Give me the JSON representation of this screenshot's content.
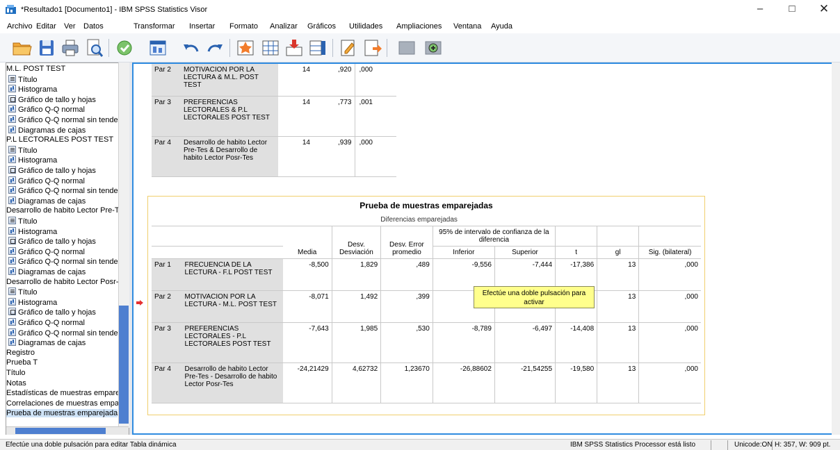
{
  "window": {
    "title": "*Resultado1 [Documento1] - IBM SPSS Statistics Visor",
    "minimize_glyph": "–",
    "maximize_glyph": "□",
    "close_glyph": "✕"
  },
  "menu": [
    "Archivo",
    "Editar",
    "Ver",
    "Datos",
    "Transformar",
    "Insertar",
    "Formato",
    "Analizar",
    "Gráficos",
    "Utilidades",
    "Ampliaciones",
    "Ventana",
    "Ayuda"
  ],
  "toolbar_icons": [
    "open-folder-icon",
    "save-icon",
    "print-icon",
    "print-preview-icon",
    "export-icon",
    "recall-dialog-icon",
    "undo-icon",
    "redo-icon",
    "goto-case-icon",
    "goto-variable-icon",
    "insert-cases-icon",
    "insert-variable-icon",
    "split-file-icon",
    "weight-cases-icon",
    "hide-icon",
    "show-icon"
  ],
  "outline": {
    "items": [
      {
        "label": "M.L. POST TEST",
        "icon": "folder"
      },
      {
        "label": "Título",
        "icon": "title"
      },
      {
        "label": "Histograma",
        "icon": "chart"
      },
      {
        "label": "Gráfico de tallo y hojas",
        "icon": "stem"
      },
      {
        "label": "Gráfico Q-Q normal",
        "icon": "chart"
      },
      {
        "label": "Gráfico Q-Q normal sin tende",
        "icon": "chart"
      },
      {
        "label": "Diagramas de cajas",
        "icon": "chart"
      },
      {
        "label": "P.L LECTORALES POST TEST",
        "icon": "folder"
      },
      {
        "label": "Título",
        "icon": "title"
      },
      {
        "label": "Histograma",
        "icon": "chart"
      },
      {
        "label": "Gráfico de tallo y hojas",
        "icon": "stem"
      },
      {
        "label": "Gráfico Q-Q normal",
        "icon": "chart"
      },
      {
        "label": "Gráfico Q-Q normal sin tende",
        "icon": "chart"
      },
      {
        "label": "Diagramas de cajas",
        "icon": "chart"
      },
      {
        "label": "Desarrollo de habito Lector Pre-T",
        "icon": "folder"
      },
      {
        "label": "Título",
        "icon": "title"
      },
      {
        "label": "Histograma",
        "icon": "chart"
      },
      {
        "label": "Gráfico de tallo y hojas",
        "icon": "stem"
      },
      {
        "label": "Gráfico Q-Q normal",
        "icon": "chart"
      },
      {
        "label": "Gráfico Q-Q normal sin tende",
        "icon": "chart"
      },
      {
        "label": "Diagramas de cajas",
        "icon": "chart"
      },
      {
        "label": "Desarrollo de habito Lector Posr-",
        "icon": "folder"
      },
      {
        "label": "Título",
        "icon": "title"
      },
      {
        "label": "Histograma",
        "icon": "chart"
      },
      {
        "label": "Gráfico de tallo y hojas",
        "icon": "stem"
      },
      {
        "label": "Gráfico Q-Q normal",
        "icon": "chart"
      },
      {
        "label": "Gráfico Q-Q normal sin tende",
        "icon": "chart"
      },
      {
        "label": "Diagramas de cajas",
        "icon": "chart"
      },
      {
        "label": "Registro",
        "icon": "none"
      },
      {
        "label": "Prueba T",
        "icon": "none"
      },
      {
        "label": "Título",
        "icon": "none"
      },
      {
        "label": "Notas",
        "icon": "none"
      },
      {
        "label": "Estadísticas de muestras empare",
        "icon": "none"
      },
      {
        "label": "Correlaciones de muestras empa",
        "icon": "none"
      },
      {
        "label": "Prueba de muestras emparejada",
        "icon": "none",
        "selected": true
      }
    ]
  },
  "correlations_partial": {
    "rows": [
      {
        "par": "Par 2",
        "label": "MOTIVACION POR LA LECTURA & M.L. POST TEST",
        "n": "14",
        "corr": ",920",
        "sig": ",000"
      },
      {
        "par": "Par 3",
        "label": "PREFERENCIAS LECTORALES & P.L LECTORALES POST TEST",
        "n": "14",
        "corr": ",773",
        "sig": ",001"
      },
      {
        "par": "Par 4",
        "label": "Desarrollo de habito Lector Pre-Tes & Desarrollo de habito Lector Posr-Tes",
        "n": "14",
        "corr": ",939",
        "sig": ",000"
      }
    ]
  },
  "paired_test": {
    "title": "Prueba de muestras emparejadas",
    "group_header": "Diferencias emparejadas",
    "ci_header": "95% de intervalo de confianza de la diferencia",
    "columns": [
      "Media",
      "Desv. Desviación",
      "Desv. Error promedio",
      "Inferior",
      "Superior",
      "t",
      "gl",
      "Sig. (bilateral)"
    ],
    "rows": [
      {
        "par": "Par 1",
        "label": "FRECUENCIA DE LA LECTURA - F.L POST TEST",
        "values": [
          "-8,500",
          "1,829",
          ",489",
          "-9,556",
          "-7,444",
          "-17,386",
          "13",
          ",000"
        ]
      },
      {
        "par": "Par 2",
        "label": "MOTIVACION POR LA LECTURA - M.L. POST TEST",
        "values": [
          "-8,071",
          "1,492",
          ",399",
          "-",
          "",
          "",
          "13",
          ",000"
        ]
      },
      {
        "par": "Par 3",
        "label": "PREFERENCIAS LECTORALES - P.L LECTORALES POST TEST",
        "values": [
          "-7,643",
          "1,985",
          ",530",
          "-8,789",
          "-6,497",
          "-14,408",
          "13",
          ",000"
        ]
      },
      {
        "par": "Par 4",
        "label": "Desarrollo de habito Lector Pre-Tes - Desarrollo de habito Lector Posr-Tes",
        "values": [
          "-24,21429",
          "4,62732",
          "1,23670",
          "-26,88602",
          "-21,54255",
          "-19,580",
          "13",
          ",000"
        ]
      }
    ]
  },
  "tooltip": "Efectúe una doble pulsación para activar",
  "status": {
    "left": "Efectúe una doble pulsación para editar Tabla dinámica",
    "processor": "IBM SPSS Statistics Processor está listo",
    "unicode": "Unicode:ON",
    "dims": "H: 357, W: 909 pt."
  },
  "colors": {
    "accent": "#2f8be0",
    "row_header": "#e0e0e0",
    "tooltip": "#ffff8c",
    "arrow": "#e53030",
    "scroll_thumb": "#4e7fd0"
  }
}
